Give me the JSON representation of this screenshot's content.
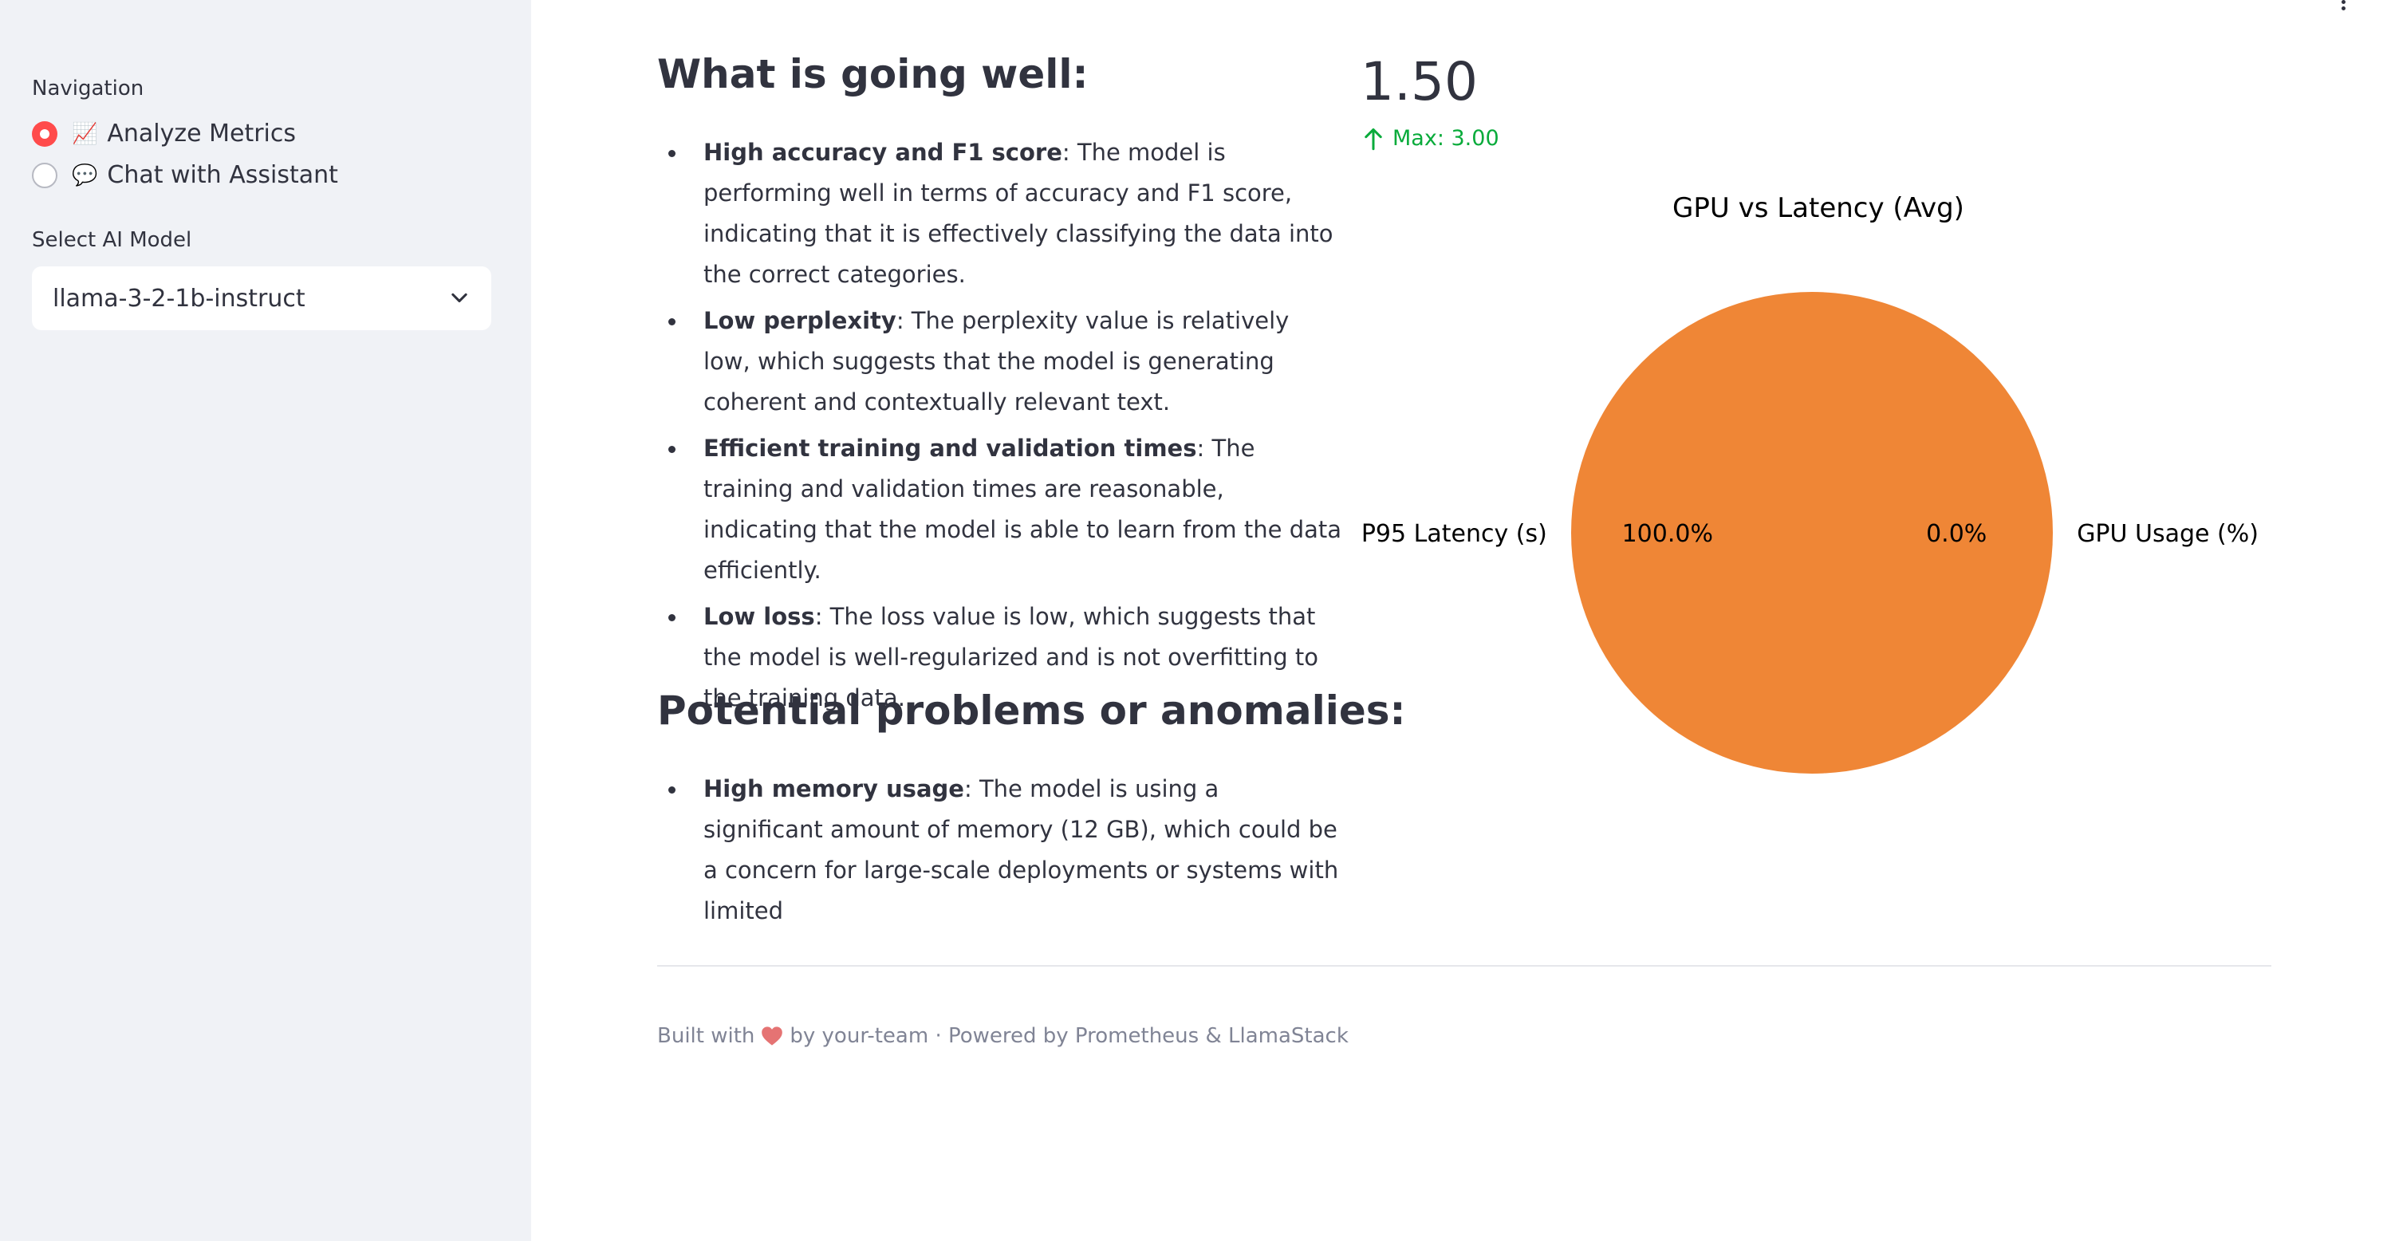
{
  "sidebar": {
    "navigation_label": "Navigation",
    "nav_options": [
      {
        "emoji": "📈",
        "label": "Analyze Metrics",
        "selected": true
      },
      {
        "emoji": "💬",
        "label": "Chat with Assistant",
        "selected": false
      }
    ],
    "model_label": "Select AI Model",
    "model_selected": "llama-3-2-1b-instruct"
  },
  "main": {
    "section1_title": "What is going well:",
    "section1_items": [
      {
        "bold": "High accuracy and F1 score",
        "text": ": The model is performing well in terms of accuracy and F1 score, indicating that it is effectively classifying the data into the correct categories."
      },
      {
        "bold": "Low perplexity",
        "text": ": The perplexity value is relatively low, which suggests that the model is generating coherent and contextually relevant text."
      },
      {
        "bold": "Efficient training and validation times",
        "text": ": The training and validation times are reasonable, indicating that the model is able to learn from the data efficiently."
      },
      {
        "bold": "Low loss",
        "text": ": The loss value is low, which suggests that the model is well-regularized and is not overfitting to the training data."
      }
    ],
    "section2_title": "Potential problems or anomalies:",
    "section2_items": [
      {
        "bold": "High memory usage",
        "text": ": The model is using a significant amount of memory (12 GB), which could be a concern for large-scale deployments or systems with limited"
      }
    ]
  },
  "metric": {
    "value": "1.50",
    "delta": "Max: 3.00",
    "delta_color": "#09ab3b"
  },
  "chart_data": {
    "type": "pie",
    "title": "GPU vs Latency (Avg)",
    "categories": [
      "GPU Usage (%)",
      "P95 Latency (s)"
    ],
    "values": [
      0.0,
      100.0
    ],
    "pct_labels": [
      "0.0%",
      "100.0%"
    ],
    "colors": [
      "#1f77b4",
      "#ef8636"
    ]
  },
  "footer": {
    "prefix": "Built with",
    "suffix": "by your-team · Powered by Prometheus & LlamaStack"
  }
}
